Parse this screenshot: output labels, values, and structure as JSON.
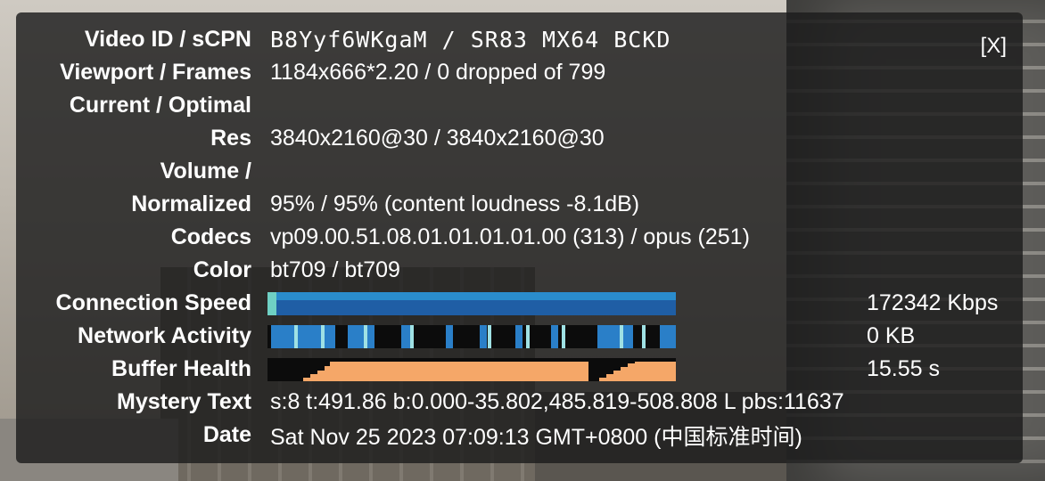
{
  "close_label": "[X]",
  "rows": [
    {
      "label": "Video ID / sCPN",
      "value": "B8Yyf6WKgaM / SR83 MX64 BCKD"
    },
    {
      "label": "Viewport / Frames",
      "value": "1184x666*2.20 / 0 dropped of 799"
    },
    {
      "label": "Current / Optimal",
      "value": ""
    },
    {
      "label": "Res",
      "value": "3840x2160@30 / 3840x2160@30"
    },
    {
      "label": "Volume /",
      "value": ""
    },
    {
      "label": "Normalized",
      "value": "95% / 95% (content loudness -8.1dB)"
    },
    {
      "label": "Codecs",
      "value": "vp09.00.51.08.01.01.01.01.00 (313) / opus (251)"
    },
    {
      "label": "Color",
      "value": "bt709 / bt709"
    },
    {
      "label": "Connection Speed",
      "stat": "172342 Kbps"
    },
    {
      "label": "Network Activity",
      "stat": "0 KB"
    },
    {
      "label": "Buffer Health",
      "stat": "15.55 s"
    },
    {
      "label": "Mystery Text",
      "value": "s:8 t:491.86 b:0.000-35.802,485.819-508.808 L pbs:11637"
    },
    {
      "label": "Date",
      "value": "Sat Nov 25 2023 07:09:13 GMT+0800 (中国标准时间)"
    }
  ],
  "colors": {
    "connection_speed": "#1f5ea5",
    "network_activity": "#2a7fc8",
    "buffer_health": "#f5a768"
  }
}
